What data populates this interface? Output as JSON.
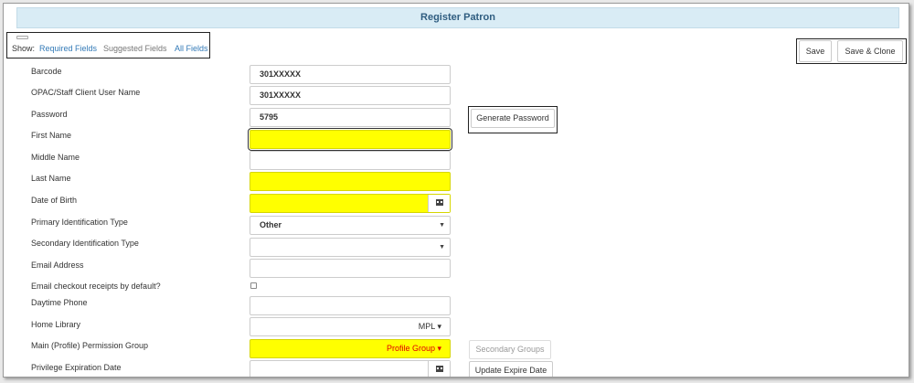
{
  "header": {
    "title": "Register Patron"
  },
  "show": {
    "label": "Show:",
    "required": "Required Fields",
    "suggested": "Suggested Fields",
    "all": "All Fields"
  },
  "toolbar": {
    "save": "Save",
    "save_clone": "Save & Clone"
  },
  "fields": {
    "barcode": {
      "label": "Barcode",
      "value": "301XXXXX"
    },
    "username": {
      "label": "OPAC/Staff Client User Name",
      "value": "301XXXXX"
    },
    "password": {
      "label": "Password",
      "value": "5795"
    },
    "first_name": {
      "label": "First Name",
      "value": ""
    },
    "middle_name": {
      "label": "Middle Name",
      "value": ""
    },
    "last_name": {
      "label": "Last Name",
      "value": ""
    },
    "dob": {
      "label": "Date of Birth",
      "value": ""
    },
    "primary_id": {
      "label": "Primary Identification Type",
      "value": "Other"
    },
    "secondary_id": {
      "label": "Secondary Identification Type",
      "value": ""
    },
    "email": {
      "label": "Email Address",
      "value": ""
    },
    "email_receipts": {
      "label": "Email checkout receipts by default?"
    },
    "daytime_phone": {
      "label": "Daytime Phone",
      "value": ""
    },
    "home_library": {
      "label": "Home Library",
      "value": "MPL"
    },
    "profile_group": {
      "label": "Main (Profile) Permission Group",
      "value": "Profile Group"
    },
    "expire_date": {
      "label": "Privilege Expiration Date",
      "value": ""
    }
  },
  "buttons": {
    "generate_password": "Generate Password",
    "secondary_groups": "Secondary Groups",
    "update_expire": "Update Expire Date"
  },
  "colors": {
    "required_bg": "#ffff00",
    "link": "#337ab7",
    "header_bg": "#d9ecf5",
    "profile_group_text": "#e00000"
  }
}
